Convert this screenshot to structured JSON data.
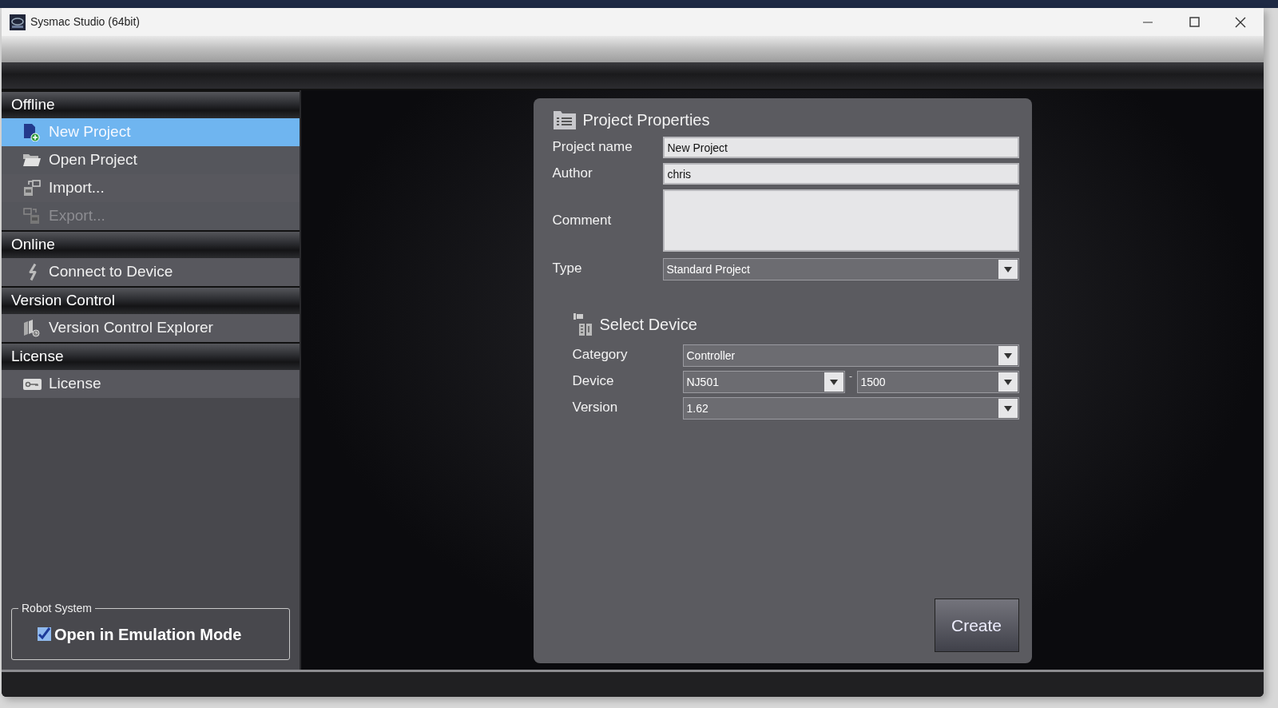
{
  "window": {
    "title": "Sysmac Studio (64bit)"
  },
  "sidebar": {
    "sections": [
      {
        "title": "Offline",
        "items": [
          {
            "label": "New Project",
            "kind": "new",
            "selected": true,
            "disabled": false
          },
          {
            "label": "Open Project",
            "kind": "open",
            "selected": false,
            "disabled": false
          },
          {
            "label": "Import...",
            "kind": "import",
            "selected": false,
            "disabled": false
          },
          {
            "label": "Export...",
            "kind": "export",
            "selected": false,
            "disabled": true
          }
        ]
      },
      {
        "title": "Online",
        "items": [
          {
            "label": "Connect to Device",
            "kind": "connect",
            "selected": false,
            "disabled": false
          }
        ]
      },
      {
        "title": "Version Control",
        "items": [
          {
            "label": "Version Control Explorer",
            "kind": "version",
            "selected": false,
            "disabled": false
          }
        ]
      },
      {
        "title": "License",
        "items": [
          {
            "label": "License",
            "kind": "license",
            "selected": false,
            "disabled": false
          }
        ]
      }
    ]
  },
  "robot_system": {
    "title": "Robot System",
    "option": {
      "label": "Open in Emulation Mode",
      "checked": true
    }
  },
  "project_properties": {
    "title": "Project Properties",
    "fields": [
      {
        "label": "Project name",
        "kind": "text",
        "value": "New Project"
      },
      {
        "label": "Author",
        "kind": "text",
        "value": "chris"
      },
      {
        "label": "Comment",
        "kind": "textarea"
      },
      {
        "label": "Type",
        "kind": "select",
        "value": "Standard Project"
      }
    ]
  },
  "select_device": {
    "title": "Select Device",
    "fields": [
      {
        "label": "Category",
        "values": [
          "Controller"
        ]
      },
      {
        "label": "Device",
        "values": [
          "NJ501",
          "1500"
        ],
        "separator": "-"
      },
      {
        "label": "Version",
        "values": [
          "1.62"
        ]
      }
    ]
  },
  "create_button": "Create"
}
